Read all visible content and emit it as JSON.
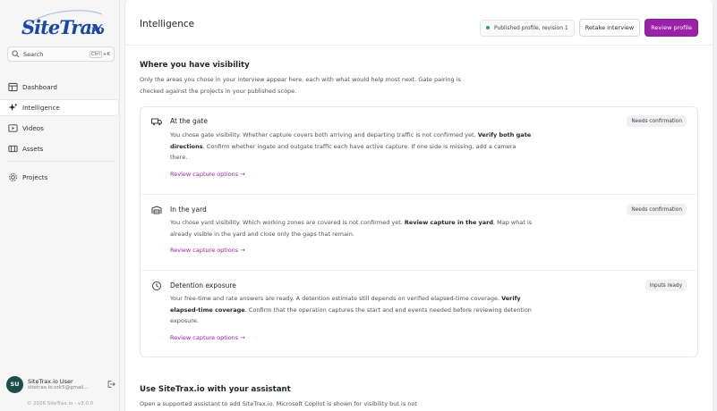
{
  "app": {
    "logo_text": "SiteTrax.io",
    "brand_color": "#1b46a8",
    "accent_color": "#9a21a8"
  },
  "search": {
    "label": "Search",
    "shortcut_key": "Ctrl",
    "shortcut_letter": "+K"
  },
  "sidebar": {
    "items": [
      {
        "label": "Dashboard",
        "icon": "dashboard-icon"
      },
      {
        "label": "Intelligence",
        "icon": "sparkle-icon"
      },
      {
        "label": "Videos",
        "icon": "video-icon"
      },
      {
        "label": "Assets",
        "icon": "assets-icon"
      },
      {
        "label": "Projects",
        "icon": "gear-icon"
      }
    ]
  },
  "user": {
    "initials": "SU",
    "name": "SiteTrax.io User",
    "email": "sitetrax.io.ork5@gmail..."
  },
  "footer": {
    "copyright": "© 2026 SiteTrax.io - v3.0.0"
  },
  "header": {
    "title": "Intelligence",
    "status": "Published profile, revision 1",
    "retake_label": "Retake interview",
    "review_label": "Review profile"
  },
  "visibility": {
    "title": "Where you have visibility",
    "description": "Only the areas you chose in your interview appear here, each with what would help most next. Gate pairing is checked against the projects in your published scope.",
    "items": [
      {
        "title": "At the gate",
        "badge": "Needs confirmation",
        "icon": "truck-icon",
        "desc_pre": "You chose gate visibility. Whether capture covers both arriving and departing traffic is not confirmed yet. ",
        "desc_bold": "Verify both gate directions",
        "desc_post": ". Confirm whether ingate and outgate traffic each have active capture. If one side is missing, add a camera there.",
        "link": "Review capture options →"
      },
      {
        "title": "In the yard",
        "badge": "Needs confirmation",
        "icon": "yard-icon",
        "desc_pre": "You chose yard visibility. Which working zones are covered is not confirmed yet. ",
        "desc_bold": "Review capture in the yard",
        "desc_post": ". Map what is already visible in the yard and close only the gaps that remain.",
        "link": "Review capture options →"
      },
      {
        "title": "Detention exposure",
        "badge": "Inputs ready",
        "icon": "clock-icon",
        "desc_pre": "Your free-time and rate answers are ready. A detention estimate still depends on verified elapsed-time coverage. ",
        "desc_bold": "Verify elapsed-time coverage",
        "desc_post": ". Confirm that the operation captures the start and end events needed before reviewing detention exposure.",
        "link": "Review capture options →"
      }
    ]
  },
  "assistant": {
    "title": "Use SiteTrax.io with your assistant",
    "description": "Open a supported assistant to add SiteTrax.io. Microsoft Copilot is shown for visibility but is not"
  }
}
